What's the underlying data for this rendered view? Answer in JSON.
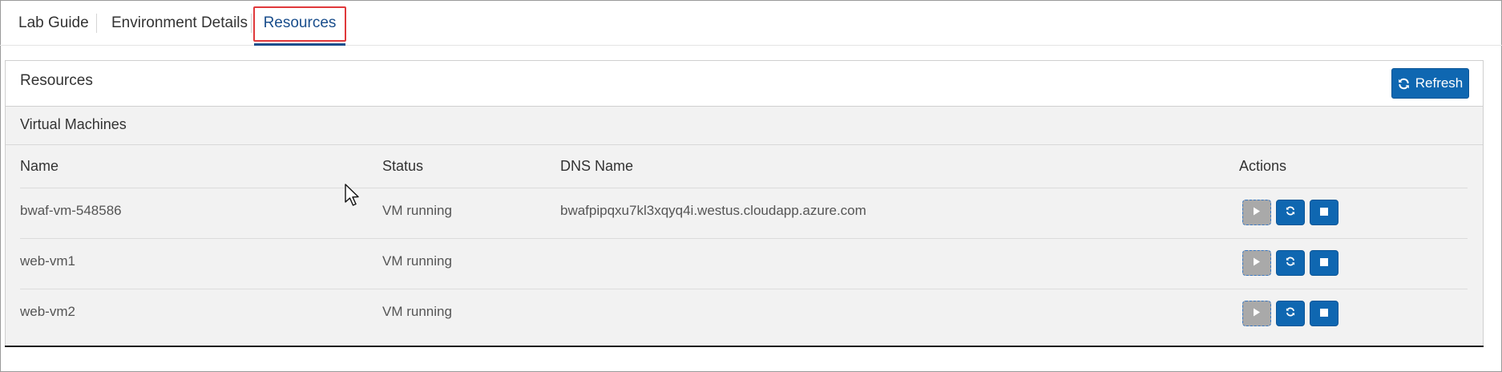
{
  "tabs": {
    "lab_guide": "Lab Guide",
    "environment_details": "Environment Details",
    "resources": "Resources",
    "active": "Resources"
  },
  "panel": {
    "title": "Resources",
    "refresh_label": "Refresh"
  },
  "vm_section": {
    "title": "Virtual Machines",
    "columns": [
      "Name",
      "Status",
      "DNS Name",
      "Actions"
    ],
    "rows": [
      {
        "name": "bwaf-vm-548586",
        "status": "VM running",
        "dns": "bwafpipqxu7kl3xqyq4i.westus.cloudapp.azure.com"
      },
      {
        "name": "web-vm1",
        "status": "VM running",
        "dns": ""
      },
      {
        "name": "web-vm2",
        "status": "VM running",
        "dns": ""
      }
    ],
    "actions": [
      "start",
      "restart",
      "stop"
    ]
  },
  "icons": {
    "refresh": "refresh-icon",
    "start": "play-icon",
    "restart": "restart-icon",
    "stop": "stop-icon",
    "cursor": "mouse-cursor-icon"
  },
  "colors": {
    "primary": "#0f67b1",
    "active_tab": "#1a4e8c",
    "highlight": "#e0393b",
    "disabled": "#a9a9a9"
  }
}
